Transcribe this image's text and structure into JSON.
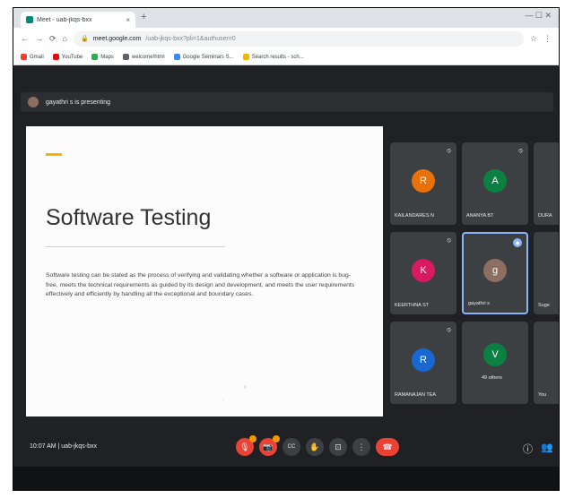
{
  "browser": {
    "tab_title": "Meet - uab-jkqs-bxx",
    "tab_close": "×",
    "new_tab": "+",
    "window_controls": "—  ☐  ✕",
    "nav": {
      "back": "←",
      "forward": "→",
      "reload": "⟳",
      "home": "⌂"
    },
    "url_host": "meet.google.com",
    "url_path": "/uab-jkqs-bxx?pli=1&authuser=0",
    "bookmarks": [
      {
        "label": "Gmail",
        "color": "#ea4335"
      },
      {
        "label": "YouTube",
        "color": "#ff0000"
      },
      {
        "label": "Maps",
        "color": "#34a853"
      },
      {
        "label": "welcome!html",
        "color": "#5f6368"
      },
      {
        "label": "Google Seminars S...",
        "color": "#4285f4"
      },
      {
        "label": "Search results - sch...",
        "color": "#f4b400"
      }
    ]
  },
  "meet": {
    "presenting_text": "gayathri s is presenting",
    "slide": {
      "title": "Software Testing",
      "body": "Software testing can be stated as the process of verifying and validating whether a software or application is bug-free, meets the technical requirements as guided by its design and development, and meets the user requirements effectively and efficiently by handling all the exceptional and boundary cases."
    },
    "participants": [
      {
        "name": "KAILANDARES N",
        "initial": "R",
        "color": "#e8710a"
      },
      {
        "name": "ANANYA BT",
        "initial": "A",
        "color": "#0b8043"
      },
      {
        "name": "DURA",
        "initial": "",
        "color": ""
      },
      {
        "name": "KEERTHNA ST",
        "initial": "K",
        "color": "#d81b60"
      },
      {
        "name": "gayathri s",
        "initial": "g",
        "color": "#8d6e63"
      },
      {
        "name": "Suge",
        "initial": "",
        "color": ""
      },
      {
        "name": "RAMANAJAN TEA",
        "initial": "R",
        "color": "#1967d2"
      },
      {
        "name": "49 others",
        "initial": "V",
        "color": "#0b8043"
      },
      {
        "name": "You",
        "initial": "",
        "color": ""
      }
    ],
    "meeting_info": "10:07 AM | uab-jkqs-bxx",
    "controls": {
      "mic": "🎙",
      "camera": "📷",
      "captions": "CC",
      "raise_hand": "✋",
      "present": "⊡",
      "more": "⋮",
      "hangup": "☎",
      "info": "ⓘ",
      "people": "👥"
    }
  }
}
